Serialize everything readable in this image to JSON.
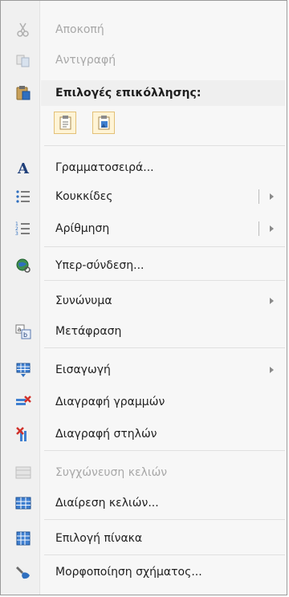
{
  "menu": {
    "cut_label": "Αποκοπή",
    "copy_label": "Αντιγραφή",
    "paste_options_label": "Επιλογές επικόλλησης:",
    "font_label": "Γραμματοσειρά...",
    "bullets_label": "Κουκκίδες",
    "numbering_label": "Αρίθμηση",
    "hyperlink_label": "Υπερ-σύνδεση...",
    "synonyms_label": "Συνώνυμα",
    "translate_label": "Μετάφραση",
    "insert_label": "Εισαγωγή",
    "delete_rows_label": "Διαγραφή γραμμών",
    "delete_columns_label": "Διαγραφή στηλών",
    "merge_cells_label": "Συγχώνευση κελιών",
    "split_cells_label": "Διαίρεση κελιών...",
    "select_table_label": "Επιλογή πίνακα",
    "format_shape_label": "Μορφοποίηση σχήματος..."
  },
  "colors": {
    "accent_blue": "#2f6fbf",
    "disabled_text": "#a8a8a8",
    "paste_highlight": "#fff4d6"
  }
}
